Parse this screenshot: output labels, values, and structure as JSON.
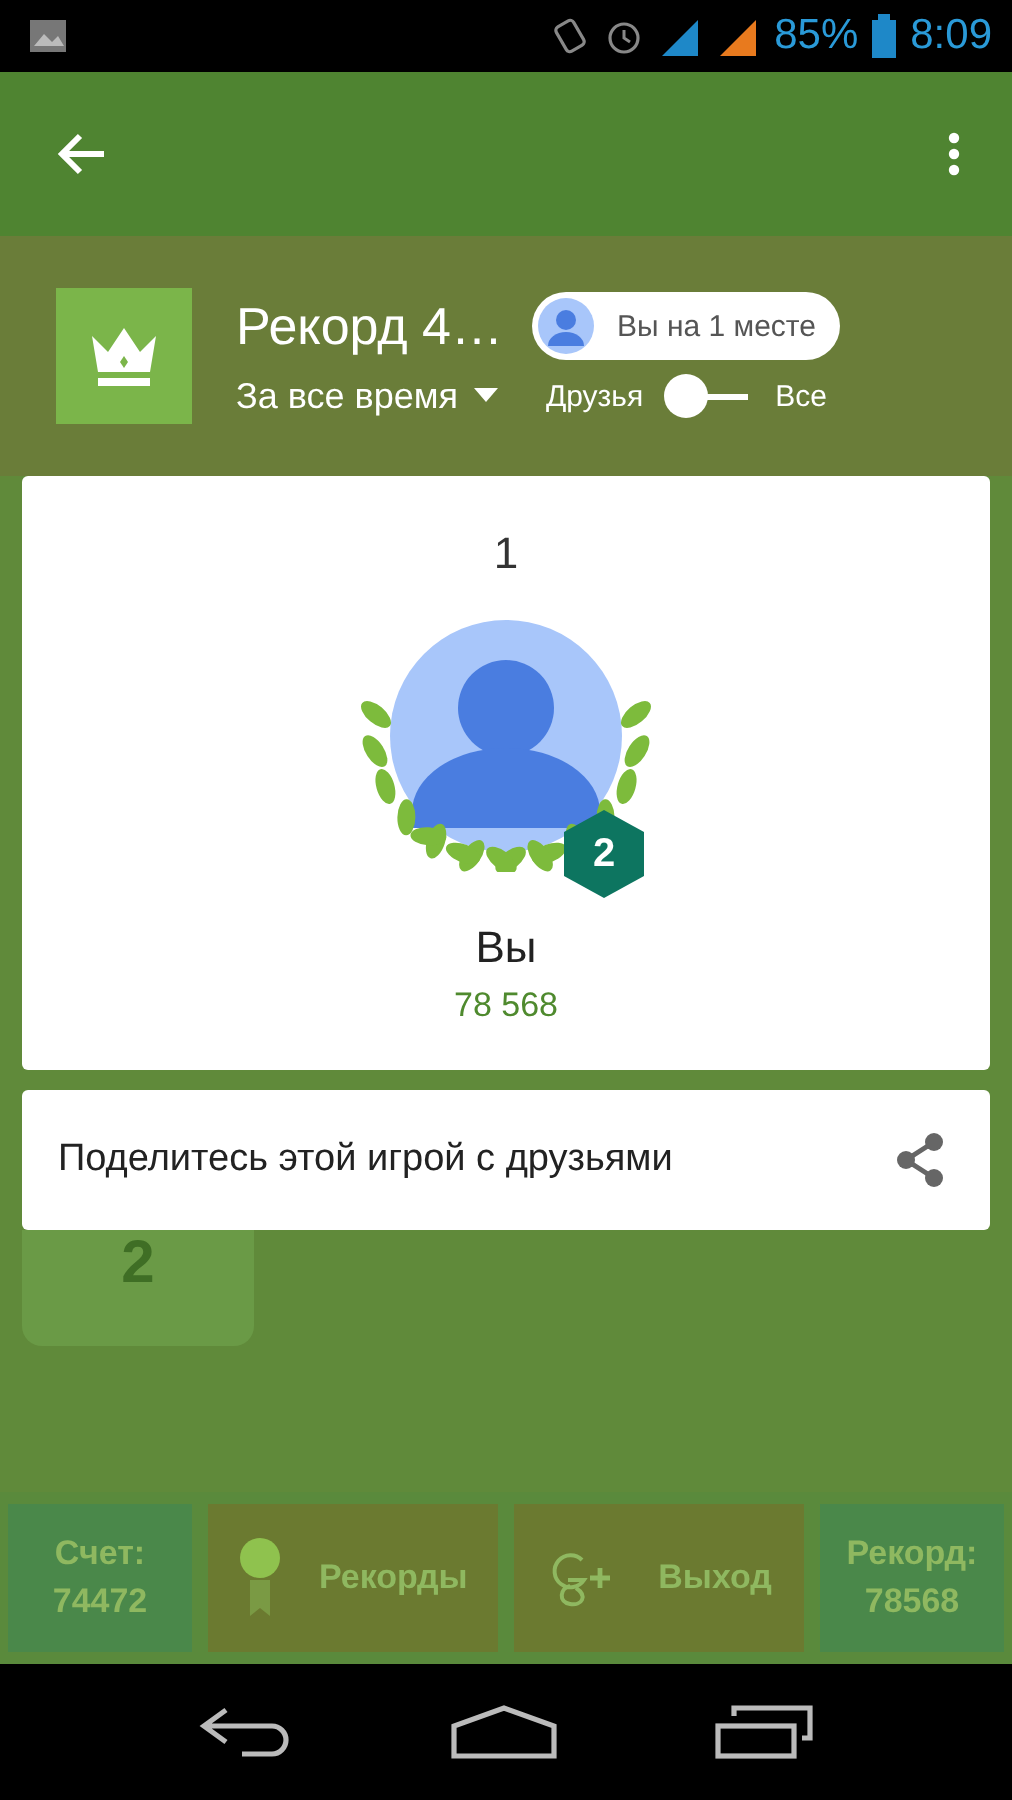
{
  "status_bar": {
    "battery": "85%",
    "time": "8:09"
  },
  "header": {
    "title": "Рекорд 4…",
    "period": "За все время",
    "rank_chip": "Вы на 1 месте",
    "toggle": {
      "left_label": "Друзья",
      "right_label": "Все",
      "on": false
    }
  },
  "player_card": {
    "rank": "1",
    "badge": "2",
    "name": "Вы",
    "score": "78 568"
  },
  "share": {
    "label": "Поделитесь этой игрой с друзьями"
  },
  "board": {
    "tile": "2"
  },
  "bottom_bar": [
    {
      "kind": "stat",
      "label": "Счет:",
      "value": "74472"
    },
    {
      "kind": "records",
      "label": "Рекорды"
    },
    {
      "kind": "gplus",
      "label": "Выход"
    },
    {
      "kind": "stat",
      "label": "Рекорд:",
      "value": "78568"
    }
  ]
}
